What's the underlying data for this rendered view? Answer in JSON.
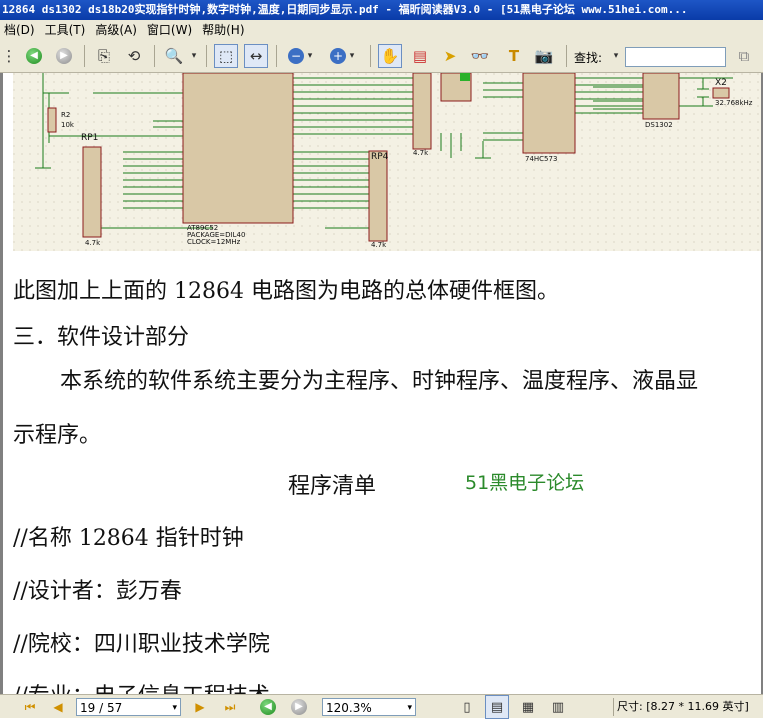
{
  "window": {
    "title": "12864 ds1302 ds18b20实现指针时钟,数字时钟,温度,日期同步显示.pdf - 福昕阅读器V3.0 - [51黑电子论坛 www.51hei.com..."
  },
  "menu": [
    "档(D)",
    "工具(T)",
    "高级(A)",
    "窗口(W)",
    "帮助(H)"
  ],
  "toolbar": {
    "search_label": "查找:",
    "search_value": ""
  },
  "document": {
    "line1": "此图加上上面的 12864 电路图为电路的总体硬件框图。",
    "line2": "三．软件设计部分",
    "line3": "本系统的软件系统主要分为主程序、时钟程序、温度程序、液晶显",
    "line4": "示程序。",
    "program_title": "程序清单",
    "forum_mark": "51黑电子论坛",
    "c1": "//名称 12864 指针时钟",
    "c2": "//设计者：彭万春",
    "c3": "//院校：四川职业技术学院",
    "c4": "//专业：电子信息工程技术"
  },
  "circuit": {
    "r2": "R2",
    "r2v": "10k",
    "rp1": "RP1",
    "rp4": "RP4",
    "x2": "X2",
    "xtal": "32.768kHz",
    "at89": "AT89C52",
    "ic1302": "DS1302",
    "ic573": "74HC573",
    "pkg": "PACKAGE=DIL40",
    "clk": "CLOCK=12MHz",
    "r47": "4.7k"
  },
  "status": {
    "page": "19 / 57",
    "zoom": "120.3%",
    "size": "尺寸: [8.27 * 11.69 英寸]"
  }
}
